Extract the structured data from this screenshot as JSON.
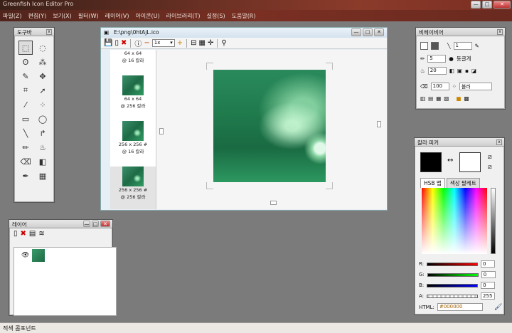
{
  "app": {
    "title": "Greenfish Icon Editor Pro"
  },
  "menu": [
    "파일(Z)",
    "편집(Y)",
    "보기(X)",
    "필터(W)",
    "레이어(V)",
    "아이콘(U)",
    "라이브러리(T)",
    "설정(S)",
    "도움말(R)"
  ],
  "toolbox": {
    "title": "도구바"
  },
  "document": {
    "title": "E:\\png\\0htAjL.ico",
    "zoom": "1x",
    "thumbnails": [
      {
        "size": "64 x 64",
        "colors": "@ 16 칼라"
      },
      {
        "size": "64 x 64",
        "colors": "@ 256 칼라"
      },
      {
        "size": "256 x 256 #",
        "colors": "@ 16 칼라"
      },
      {
        "size": "256 x 256 #",
        "colors": "@ 256 칼라"
      }
    ]
  },
  "layers": {
    "title": "레이어"
  },
  "pencil": {
    "title": "비헤이비어",
    "width": "1",
    "size": "5",
    "size_mode": "동글게",
    "opacity": "20",
    "zoom": "100",
    "blend": "블러"
  },
  "color": {
    "title": "칼라 피커",
    "tab_hsb": "HSB 맵",
    "tab_palette": "색상 팔레트",
    "r_label": "R:",
    "r": "0",
    "g_label": "G:",
    "g": "0",
    "b_label": "B:",
    "b": "0",
    "a_label": "A:",
    "a": "255",
    "html_label": "HTML:",
    "html": "#000000",
    "primary": "#000000",
    "secondary": "#ffffff"
  },
  "status": {
    "text": "적색 콤포넌트"
  }
}
